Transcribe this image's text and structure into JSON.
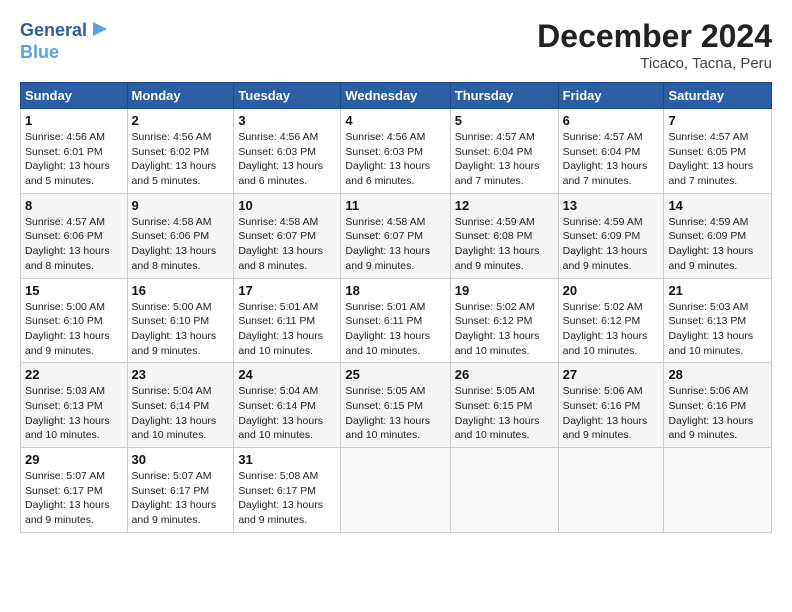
{
  "logo": {
    "line1": "General",
    "line2": "Blue"
  },
  "title": "December 2024",
  "location": "Ticaco, Tacna, Peru",
  "days_header": [
    "Sunday",
    "Monday",
    "Tuesday",
    "Wednesday",
    "Thursday",
    "Friday",
    "Saturday"
  ],
  "weeks": [
    [
      {
        "num": "1",
        "info": "Sunrise: 4:56 AM\nSunset: 6:01 PM\nDaylight: 13 hours\nand 5 minutes."
      },
      {
        "num": "2",
        "info": "Sunrise: 4:56 AM\nSunset: 6:02 PM\nDaylight: 13 hours\nand 5 minutes."
      },
      {
        "num": "3",
        "info": "Sunrise: 4:56 AM\nSunset: 6:03 PM\nDaylight: 13 hours\nand 6 minutes."
      },
      {
        "num": "4",
        "info": "Sunrise: 4:56 AM\nSunset: 6:03 PM\nDaylight: 13 hours\nand 6 minutes."
      },
      {
        "num": "5",
        "info": "Sunrise: 4:57 AM\nSunset: 6:04 PM\nDaylight: 13 hours\nand 7 minutes."
      },
      {
        "num": "6",
        "info": "Sunrise: 4:57 AM\nSunset: 6:04 PM\nDaylight: 13 hours\nand 7 minutes."
      },
      {
        "num": "7",
        "info": "Sunrise: 4:57 AM\nSunset: 6:05 PM\nDaylight: 13 hours\nand 7 minutes."
      }
    ],
    [
      {
        "num": "8",
        "info": "Sunrise: 4:57 AM\nSunset: 6:06 PM\nDaylight: 13 hours\nand 8 minutes."
      },
      {
        "num": "9",
        "info": "Sunrise: 4:58 AM\nSunset: 6:06 PM\nDaylight: 13 hours\nand 8 minutes."
      },
      {
        "num": "10",
        "info": "Sunrise: 4:58 AM\nSunset: 6:07 PM\nDaylight: 13 hours\nand 8 minutes."
      },
      {
        "num": "11",
        "info": "Sunrise: 4:58 AM\nSunset: 6:07 PM\nDaylight: 13 hours\nand 9 minutes."
      },
      {
        "num": "12",
        "info": "Sunrise: 4:59 AM\nSunset: 6:08 PM\nDaylight: 13 hours\nand 9 minutes."
      },
      {
        "num": "13",
        "info": "Sunrise: 4:59 AM\nSunset: 6:09 PM\nDaylight: 13 hours\nand 9 minutes."
      },
      {
        "num": "14",
        "info": "Sunrise: 4:59 AM\nSunset: 6:09 PM\nDaylight: 13 hours\nand 9 minutes."
      }
    ],
    [
      {
        "num": "15",
        "info": "Sunrise: 5:00 AM\nSunset: 6:10 PM\nDaylight: 13 hours\nand 9 minutes."
      },
      {
        "num": "16",
        "info": "Sunrise: 5:00 AM\nSunset: 6:10 PM\nDaylight: 13 hours\nand 9 minutes."
      },
      {
        "num": "17",
        "info": "Sunrise: 5:01 AM\nSunset: 6:11 PM\nDaylight: 13 hours\nand 10 minutes."
      },
      {
        "num": "18",
        "info": "Sunrise: 5:01 AM\nSunset: 6:11 PM\nDaylight: 13 hours\nand 10 minutes."
      },
      {
        "num": "19",
        "info": "Sunrise: 5:02 AM\nSunset: 6:12 PM\nDaylight: 13 hours\nand 10 minutes."
      },
      {
        "num": "20",
        "info": "Sunrise: 5:02 AM\nSunset: 6:12 PM\nDaylight: 13 hours\nand 10 minutes."
      },
      {
        "num": "21",
        "info": "Sunrise: 5:03 AM\nSunset: 6:13 PM\nDaylight: 13 hours\nand 10 minutes."
      }
    ],
    [
      {
        "num": "22",
        "info": "Sunrise: 5:03 AM\nSunset: 6:13 PM\nDaylight: 13 hours\nand 10 minutes."
      },
      {
        "num": "23",
        "info": "Sunrise: 5:04 AM\nSunset: 6:14 PM\nDaylight: 13 hours\nand 10 minutes."
      },
      {
        "num": "24",
        "info": "Sunrise: 5:04 AM\nSunset: 6:14 PM\nDaylight: 13 hours\nand 10 minutes."
      },
      {
        "num": "25",
        "info": "Sunrise: 5:05 AM\nSunset: 6:15 PM\nDaylight: 13 hours\nand 10 minutes."
      },
      {
        "num": "26",
        "info": "Sunrise: 5:05 AM\nSunset: 6:15 PM\nDaylight: 13 hours\nand 10 minutes."
      },
      {
        "num": "27",
        "info": "Sunrise: 5:06 AM\nSunset: 6:16 PM\nDaylight: 13 hours\nand 9 minutes."
      },
      {
        "num": "28",
        "info": "Sunrise: 5:06 AM\nSunset: 6:16 PM\nDaylight: 13 hours\nand 9 minutes."
      }
    ],
    [
      {
        "num": "29",
        "info": "Sunrise: 5:07 AM\nSunset: 6:17 PM\nDaylight: 13 hours\nand 9 minutes."
      },
      {
        "num": "30",
        "info": "Sunrise: 5:07 AM\nSunset: 6:17 PM\nDaylight: 13 hours\nand 9 minutes."
      },
      {
        "num": "31",
        "info": "Sunrise: 5:08 AM\nSunset: 6:17 PM\nDaylight: 13 hours\nand 9 minutes."
      },
      {
        "num": "",
        "info": ""
      },
      {
        "num": "",
        "info": ""
      },
      {
        "num": "",
        "info": ""
      },
      {
        "num": "",
        "info": ""
      }
    ]
  ]
}
